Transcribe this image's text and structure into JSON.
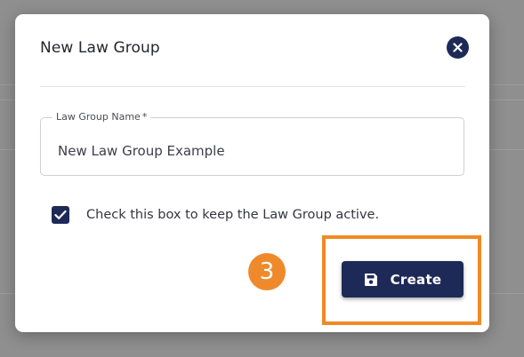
{
  "dialog": {
    "title": "New Law Group",
    "close_icon": "close-circle-icon"
  },
  "form": {
    "name_field": {
      "label": "Law Group Name",
      "required_marker": "*",
      "value": "New Law Group Example"
    },
    "active_checkbox": {
      "checked": true,
      "label": "Check this box to keep the Law Group active."
    }
  },
  "annotation": {
    "step_number": "3",
    "badge_color": "#ef8a2c",
    "highlight_color": "#f08a24"
  },
  "actions": {
    "create_label": "Create",
    "create_icon": "save-floppy-icon"
  },
  "colors": {
    "primary": "#1d2a58",
    "overlay": "#8f8f8f"
  }
}
